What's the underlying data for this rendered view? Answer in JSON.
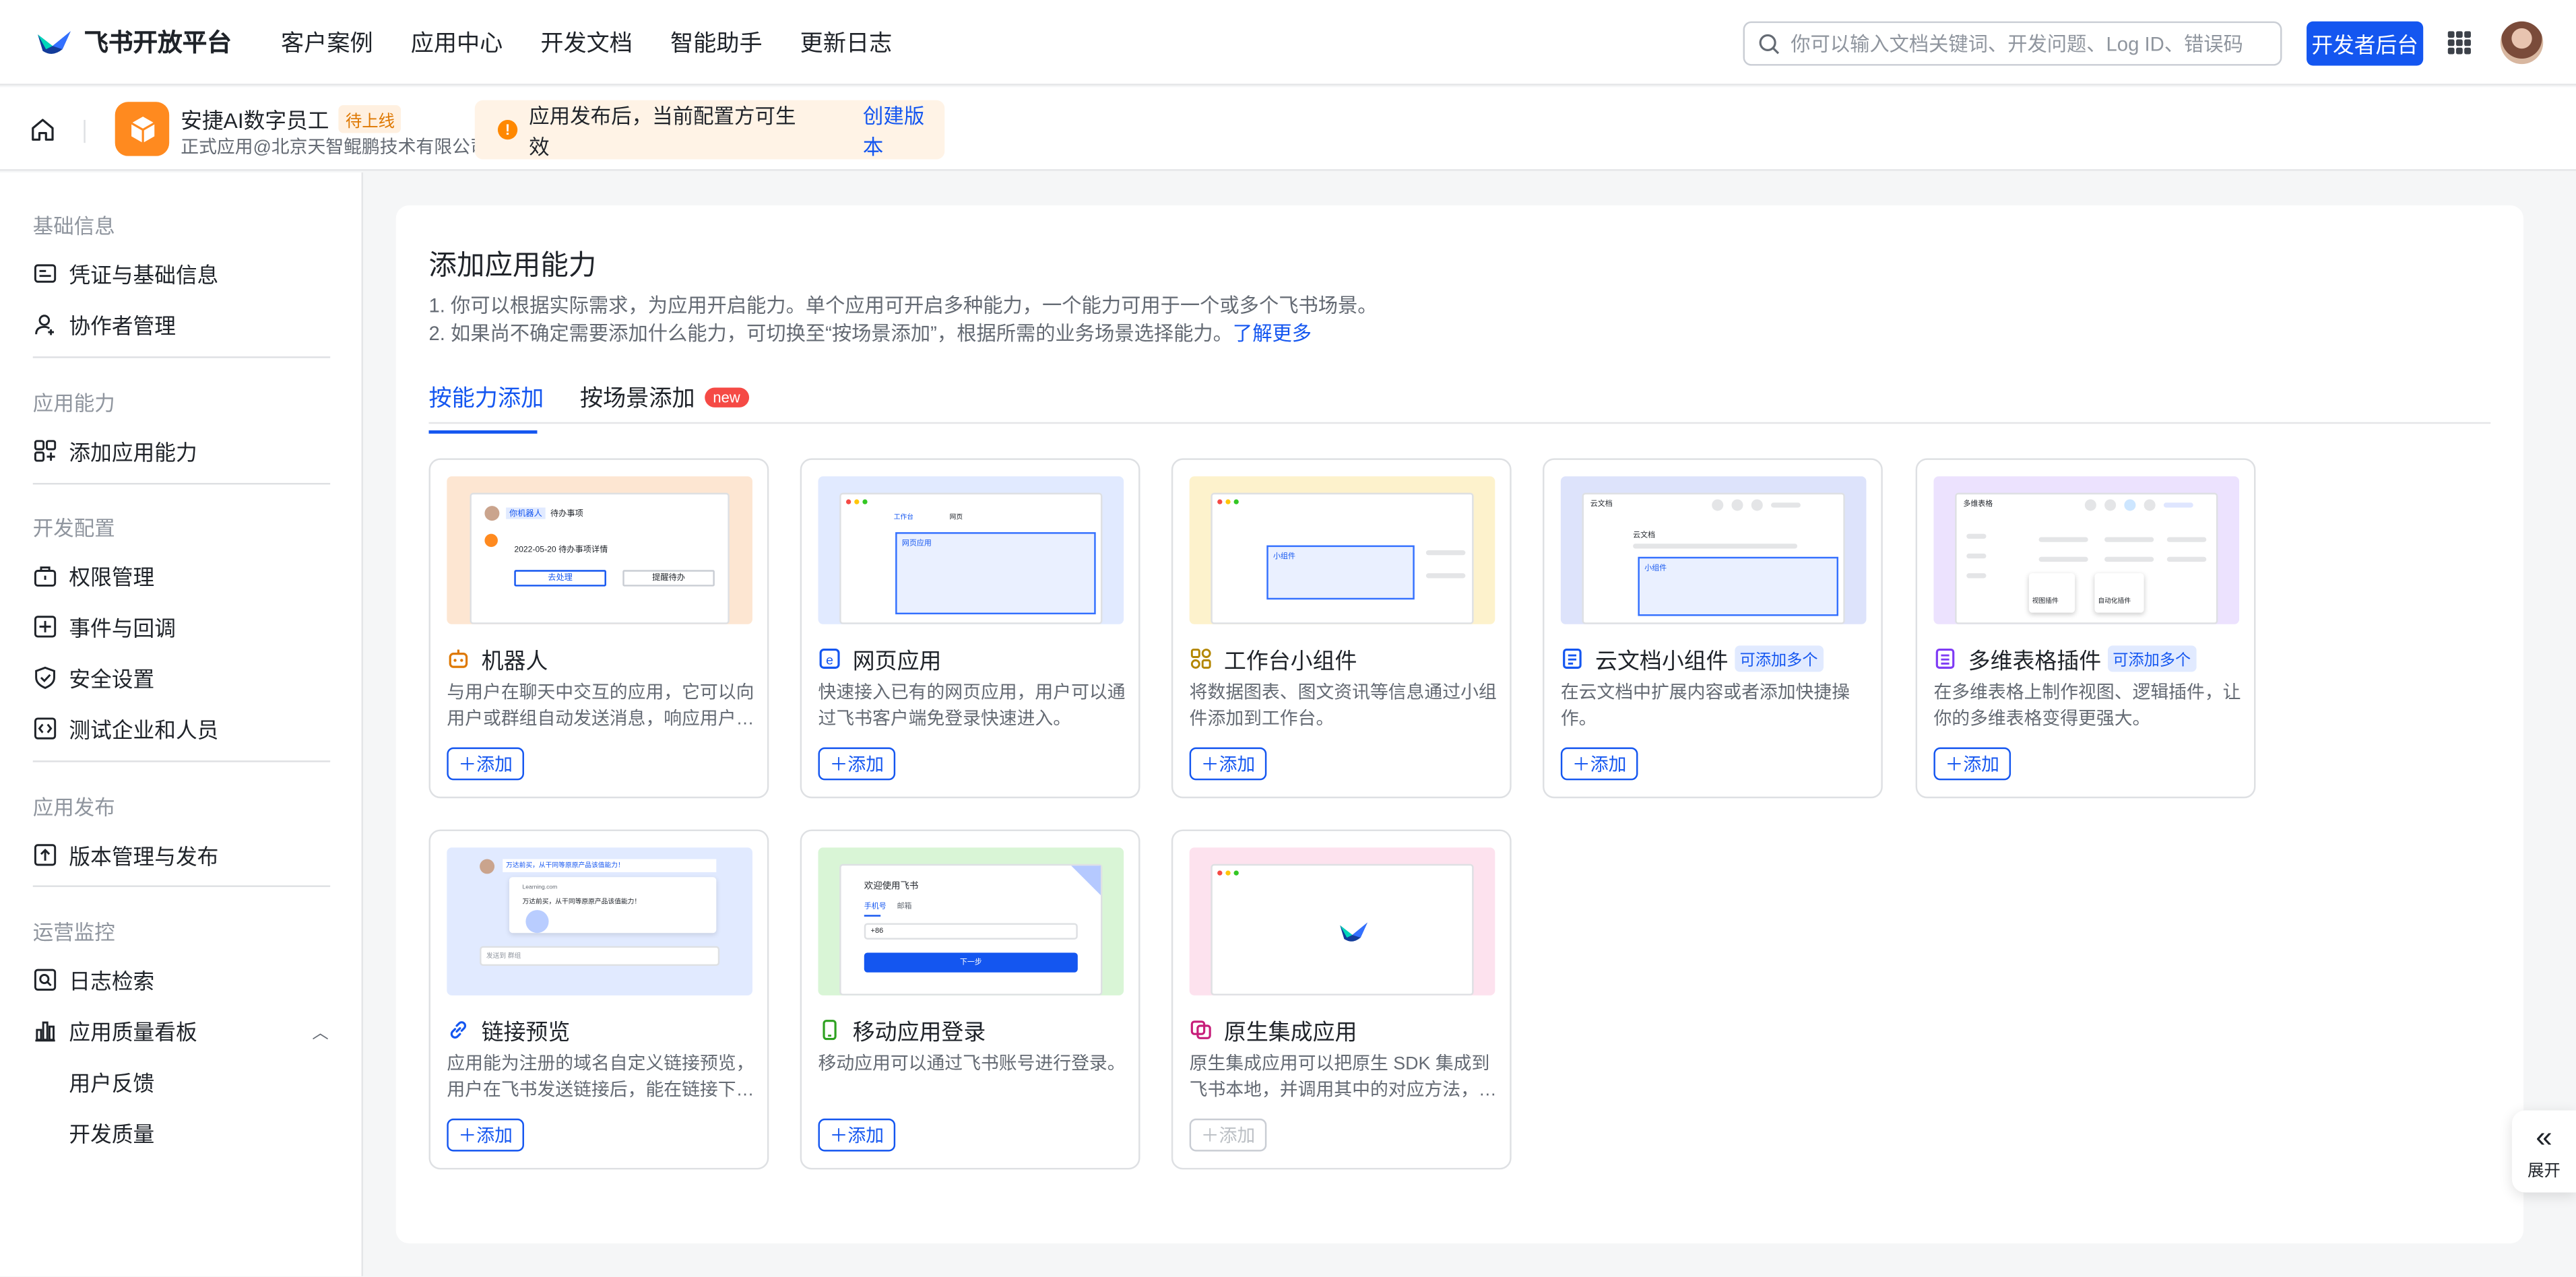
{
  "header": {
    "brand": "飞书开放平台",
    "nav": [
      "客户案例",
      "应用中心",
      "开发文档",
      "智能助手",
      "更新日志"
    ],
    "search_placeholder": "你可以输入文档关键词、开发问题、Log ID、错误码",
    "dev_console": "开发者后台"
  },
  "app": {
    "name": "安捷AI数字员工",
    "status": "待上线",
    "subtitle": "正式应用@北京天智鲲鹏技术有限公司",
    "notice": "应用发布后，当前配置方可生效",
    "create_version": "创建版本"
  },
  "sidebar": {
    "groups": [
      {
        "label": "基础信息",
        "items": [
          {
            "label": "凭证与基础信息",
            "icon": "credential-icon"
          },
          {
            "label": "协作者管理",
            "icon": "collaborator-icon"
          }
        ]
      },
      {
        "label": "应用能力",
        "items": [
          {
            "label": "添加应用能力",
            "icon": "add-ability-icon"
          }
        ]
      },
      {
        "label": "开发配置",
        "items": [
          {
            "label": "权限管理",
            "icon": "permission-icon"
          },
          {
            "label": "事件与回调",
            "icon": "event-icon"
          },
          {
            "label": "安全设置",
            "icon": "security-icon"
          },
          {
            "label": "测试企业和人员",
            "icon": "test-icon"
          }
        ]
      },
      {
        "label": "应用发布",
        "items": [
          {
            "label": "版本管理与发布",
            "icon": "version-icon"
          }
        ]
      },
      {
        "label": "运营监控",
        "items": [
          {
            "label": "日志检索",
            "icon": "log-search-icon"
          },
          {
            "label": "应用质量看板",
            "icon": "quality-icon"
          }
        ],
        "subitems": [
          "用户反馈",
          "开发质量"
        ]
      }
    ]
  },
  "main": {
    "title": "添加应用能力",
    "desc1": "1. 你可以根据实际需求，为应用开启能力。单个应用可开启多种能力，一个能力可用于一个或多个飞书场景。",
    "desc2": "2. 如果尚不确定需要添加什么能力，可切换至“按场景添加”，根据所需的业务场景选择能力。",
    "learn_more": "了解更多",
    "tabs": [
      "按能力添加",
      "按场景添加"
    ],
    "new_badge": "new",
    "add_label": "添加",
    "multi_label": "可添加多个",
    "cards": [
      {
        "title": "机器人",
        "desc": "与用户在聊天中交互的应用，它可以向用户或群组自动发送消息，响应用户的消息。",
        "icon": "robot-icon",
        "multi": false,
        "enabled": true
      },
      {
        "title": "网页应用",
        "desc": "快速接入已有的网页应用，用户可以通过飞书客户端免登录快速进入。",
        "icon": "web-app-icon",
        "multi": false,
        "enabled": true
      },
      {
        "title": "工作台小组件",
        "desc": "将数据图表、图文资讯等信息通过小组件添加到工作台。",
        "icon": "widget-icon",
        "multi": false,
        "enabled": true
      },
      {
        "title": "云文档小组件",
        "desc": "在云文档中扩展内容或者添加快捷操作。",
        "icon": "doc-widget-icon",
        "multi": true,
        "enabled": true
      },
      {
        "title": "多维表格插件",
        "desc": "在多维表格上制作视图、逻辑插件，让你的多维表格变得更强大。",
        "icon": "bitable-icon",
        "multi": true,
        "enabled": true
      },
      {
        "title": "链接预览",
        "desc": "应用能为注册的域名自定义链接预览，用户在飞书发送链接后，能在链接下方展示预览内容。",
        "icon": "link-icon",
        "multi": false,
        "enabled": true
      },
      {
        "title": "移动应用登录",
        "desc": "移动应用可以通过飞书账号进行登录。",
        "icon": "mobile-icon",
        "multi": false,
        "enabled": true
      },
      {
        "title": "原生集成应用",
        "desc": "原生集成应用可以把原生 SDK 集成到飞书本地，并调用其中的对应方法，为用户提供服务。",
        "icon": "native-icon",
        "multi": false,
        "enabled": false
      }
    ],
    "thumbs": {
      "robot_name": "你机器人",
      "robot_todo": "待办事项",
      "robot_line": "2022-05-20 待办事项详情",
      "robot_btn1": "去处理",
      "robot_btn2": "提醒待办",
      "web_tab1": "工作台",
      "web_tab2": "网页",
      "web_box": "网页应用",
      "widget_box": "小组件",
      "doc_title": "云文档",
      "doc_name": "云文档",
      "doc_box": "小组件",
      "bitable_title": "多维表格",
      "bitable_a": "视图插件",
      "bitable_b": "自动化插件",
      "link_msg": "万达前买，从干同等原原产品该值能力！",
      "link_url": "Learning.com",
      "link_body": "万达前买，从干同等原原产品该值能力！",
      "link_input": "发送到 群组",
      "mobile_title": "欢迎使用飞书",
      "mobile_tab1": "手机号",
      "mobile_tab2": "邮箱",
      "mobile_code": "+86",
      "mobile_btn": "下一步"
    }
  },
  "expand": {
    "label": "展开"
  }
}
